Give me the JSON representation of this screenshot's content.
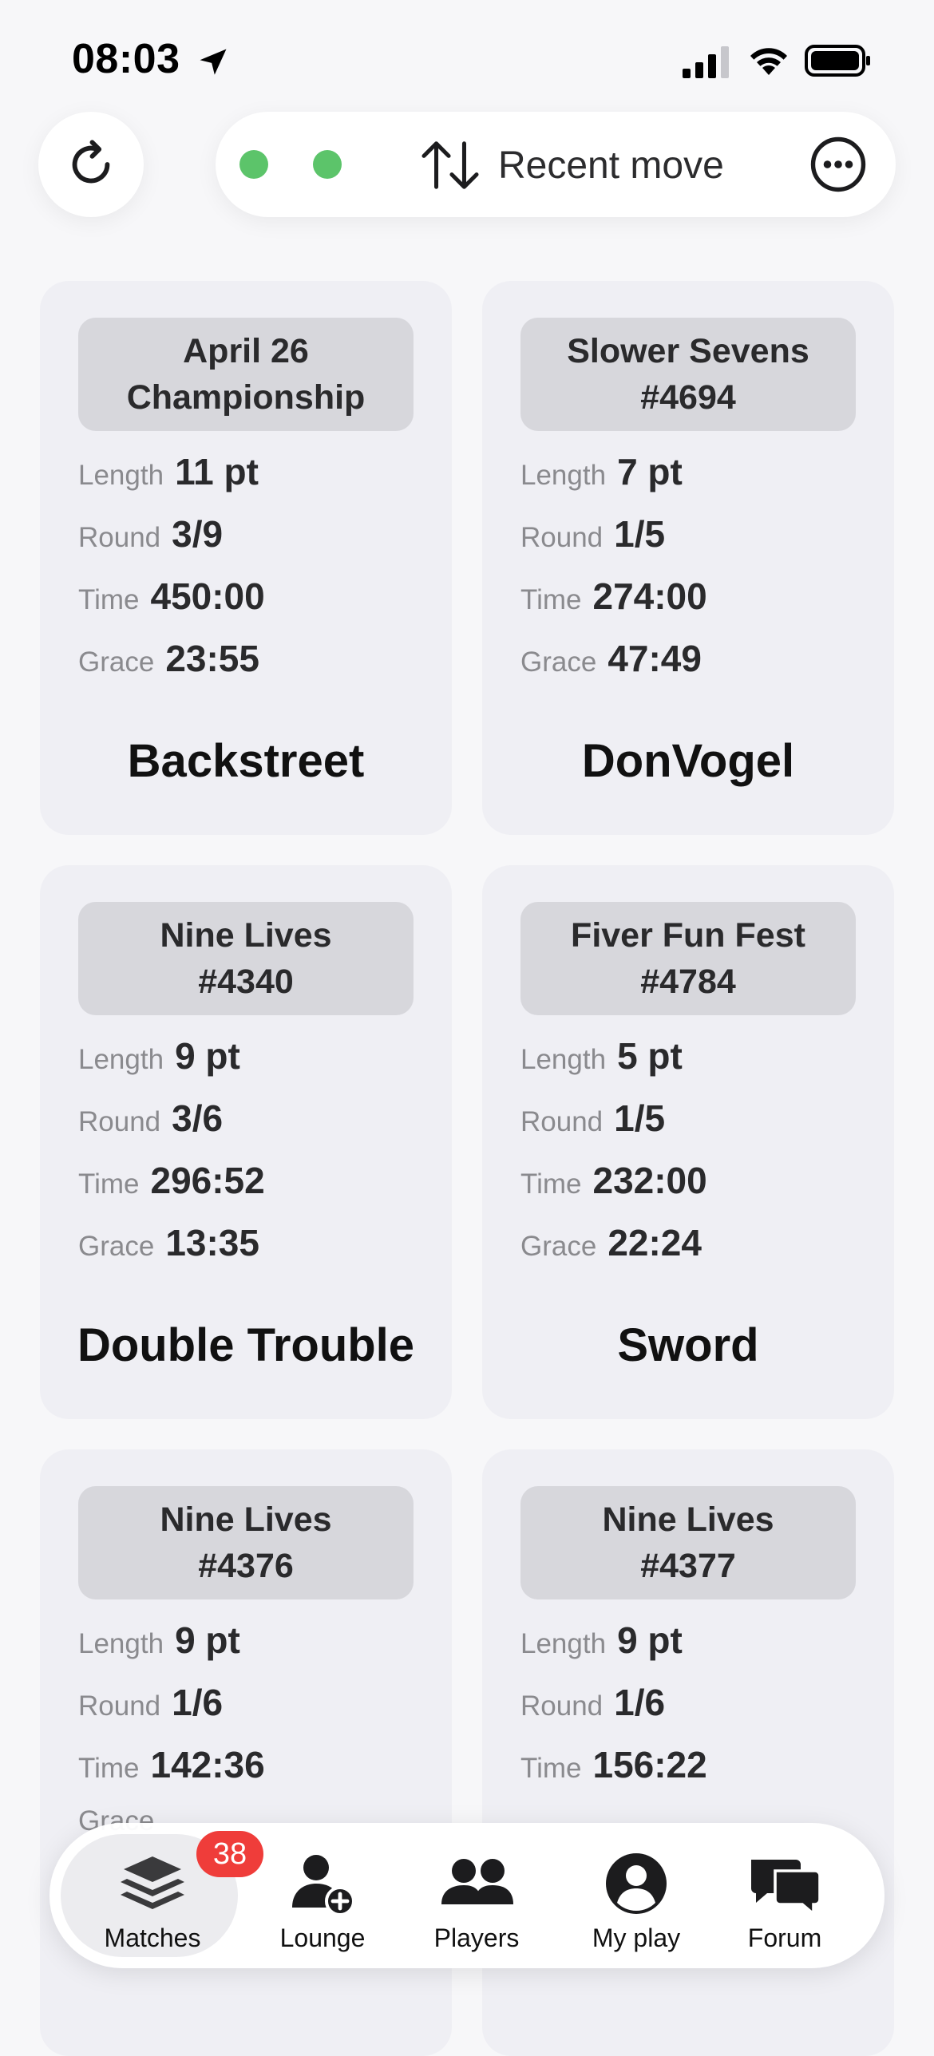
{
  "status_bar": {
    "time": "08:03"
  },
  "toolbar": {
    "sort_label": "Recent move",
    "indicator_color": "#5cc46a"
  },
  "matches": [
    {
      "title": "April 26\nChampionship",
      "length": "11 pt",
      "round": "3/9",
      "time": "450:00",
      "grace": "23:55",
      "opponent": "Backstreet"
    },
    {
      "title": "Slower Sevens\n#4694",
      "length": "7 pt",
      "round": "1/5",
      "time": "274:00",
      "grace": "47:49",
      "opponent": "DonVogel"
    },
    {
      "title": "Nine Lives\n#4340",
      "length": "9 pt",
      "round": "3/6",
      "time": "296:52",
      "grace": "13:35",
      "opponent": "Double Trouble"
    },
    {
      "title": "Fiver Fun Fest\n#4784",
      "length": "5 pt",
      "round": "1/5",
      "time": "232:00",
      "grace": "22:24",
      "opponent": "Sword"
    },
    {
      "title": "Nine Lives\n#4376",
      "length": "9 pt",
      "round": "1/6",
      "time": "142:36"
    },
    {
      "title": "Nine Lives\n#4377",
      "length": "9 pt",
      "round": "1/6",
      "time": "156:22"
    }
  ],
  "labels": {
    "length": "Length",
    "round": "Round",
    "time": "Time",
    "grace": "Grace"
  },
  "tabbar": {
    "matches": "Matches",
    "matches_badge": "38",
    "lounge": "Lounge",
    "players": "Players",
    "my_play": "My play",
    "forum": "Forum"
  }
}
